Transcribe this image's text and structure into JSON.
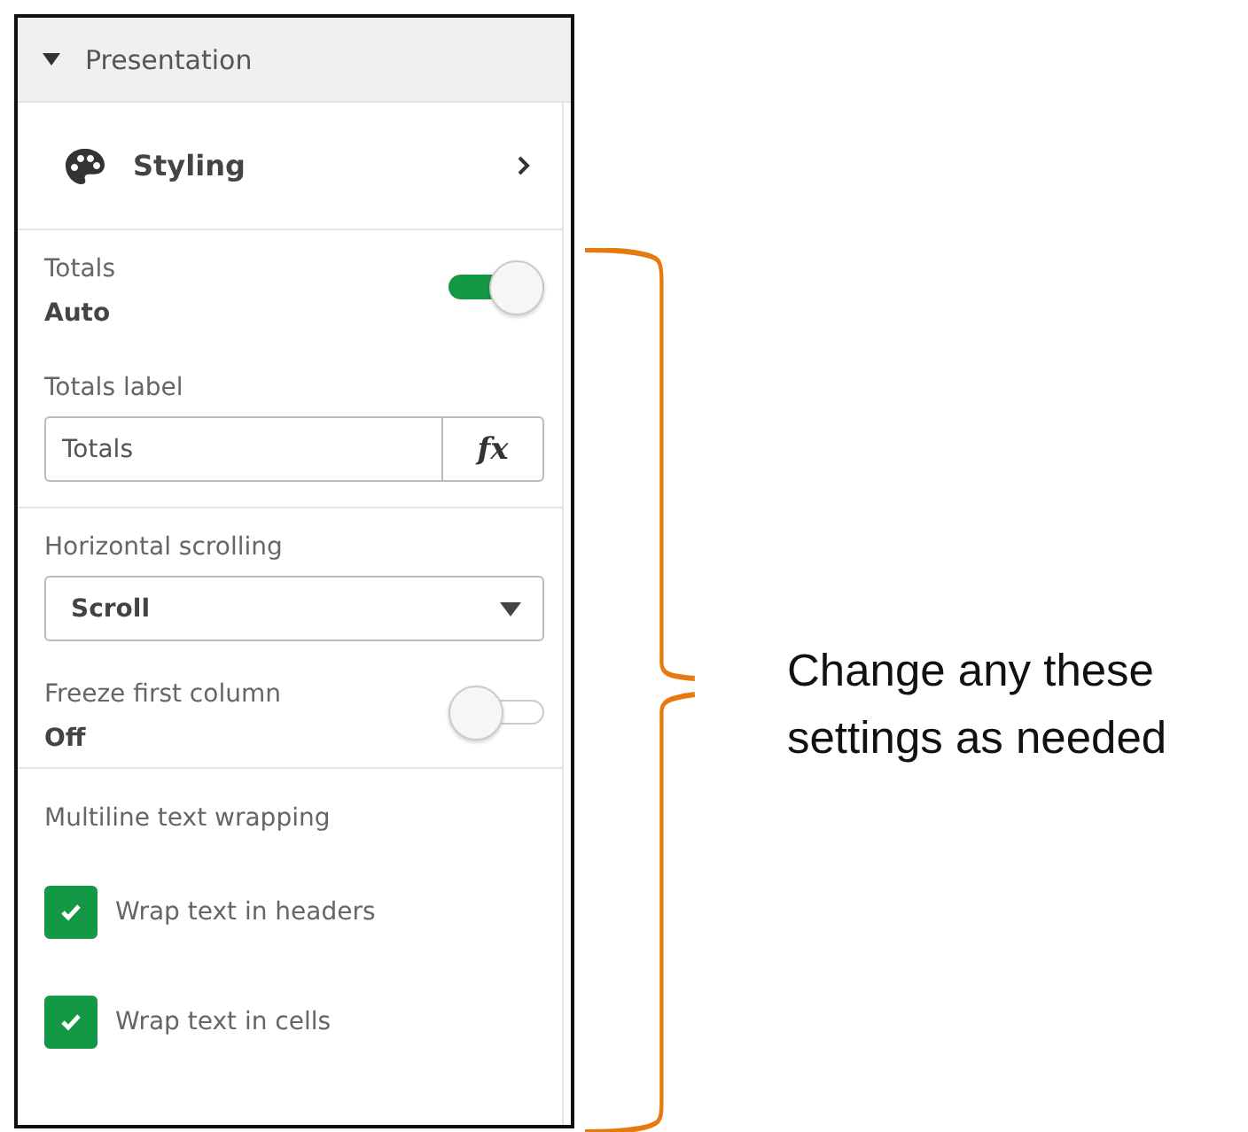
{
  "section": {
    "title": "Presentation",
    "expanded": true
  },
  "styling": {
    "label": "Styling"
  },
  "totals": {
    "label": "Totals",
    "value": "Auto",
    "on": true
  },
  "totals_label": {
    "label": "Totals label",
    "value": "Totals",
    "button": "fx"
  },
  "horizontal_scrolling": {
    "label": "Horizontal scrolling",
    "value": "Scroll"
  },
  "freeze_first_column": {
    "label": "Freeze first column",
    "value": "Off",
    "on": false
  },
  "multiline": {
    "label": "Multiline text wrapping",
    "options": [
      {
        "label": "Wrap text in headers",
        "checked": true
      },
      {
        "label": "Wrap text in cells",
        "checked": true
      }
    ]
  },
  "annotation": "Change any these settings as needed"
}
